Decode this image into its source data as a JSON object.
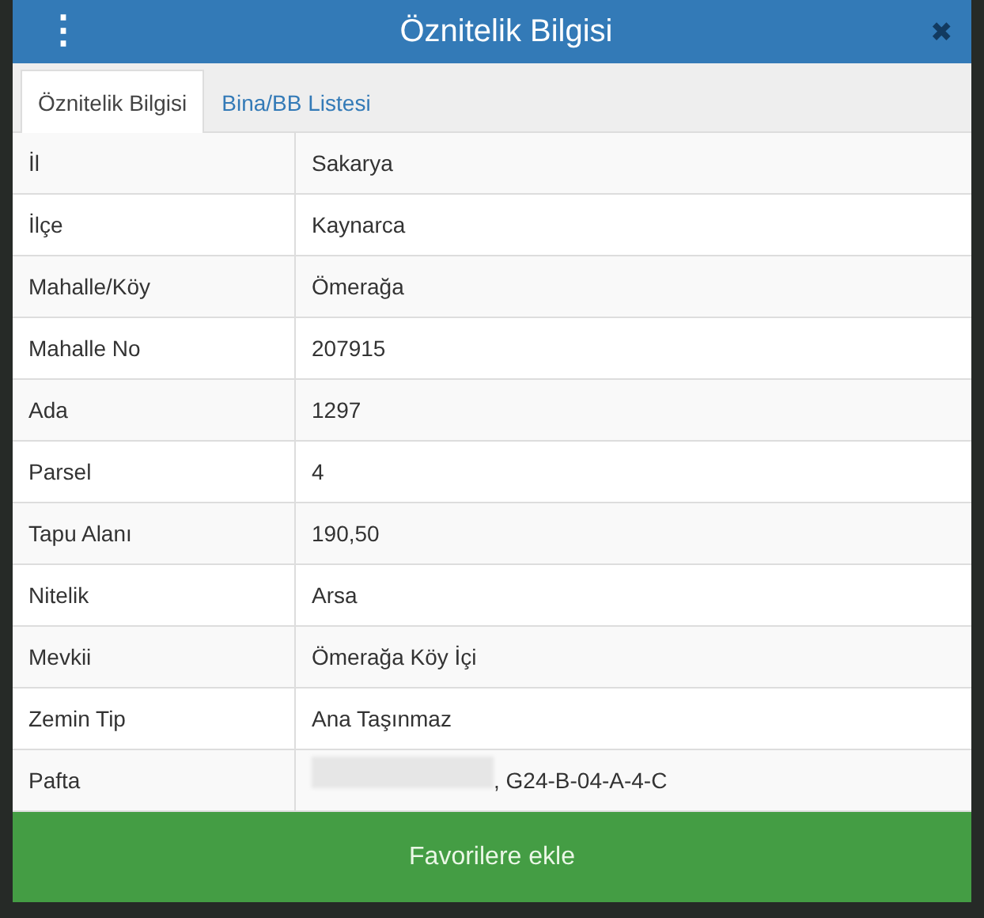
{
  "dialog": {
    "title": "Öznitelik Bilgisi",
    "menu_icon": "⋮",
    "close_icon": "✖"
  },
  "tabs": [
    {
      "label": "Öznitelik Bilgisi",
      "selected": true
    },
    {
      "label": "Bina/BB Listesi",
      "selected": false
    }
  ],
  "rows": [
    {
      "label": "İl",
      "value": "Sakarya",
      "kind": "plain"
    },
    {
      "label": "İlçe",
      "value": "Kaynarca",
      "kind": "plain"
    },
    {
      "label": "Mahalle/Köy",
      "value": "Ömerağa",
      "kind": "plain"
    },
    {
      "label": "Mahalle No",
      "value": "207915",
      "kind": "plain"
    },
    {
      "label": "Ada",
      "value": "1297",
      "kind": "plain"
    },
    {
      "label": "Parsel",
      "value": "4",
      "kind": "plain"
    },
    {
      "label": "Tapu Alanı",
      "value": "190,50",
      "kind": "plain"
    },
    {
      "label": "Nitelik",
      "value": "Arsa",
      "kind": "plain"
    },
    {
      "label": "Mevkii",
      "value": "Ömerağa Köy İçi",
      "kind": "plain"
    },
    {
      "label": "Zemin Tip",
      "value": "Ana Taşınmaz",
      "kind": "plain"
    },
    {
      "label": "Pafta",
      "value": ", G24-B-04-A-4-C",
      "kind": "redacted"
    }
  ],
  "button": {
    "label": "Favorilere ekle"
  }
}
